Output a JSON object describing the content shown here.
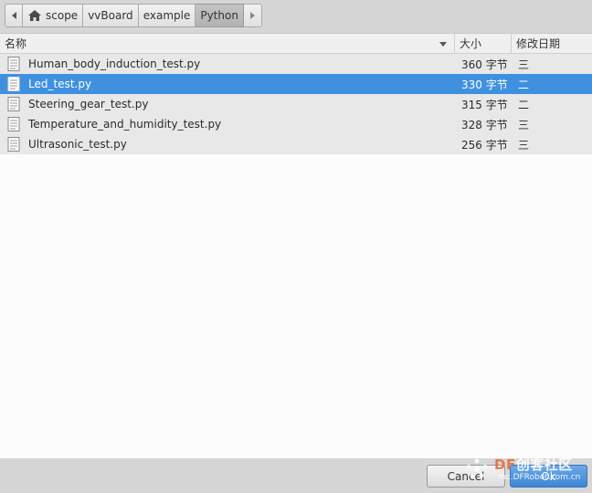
{
  "pathbar": {
    "crumbs": [
      "scope",
      "vvBoard",
      "example",
      "Python"
    ]
  },
  "columns": {
    "name": "名称",
    "size": "大小",
    "date": "修改日期"
  },
  "files": [
    {
      "name": "Human_body_induction_test.py",
      "size": "360 字节",
      "date": "三"
    },
    {
      "name": "Led_test.py",
      "size": "330 字节",
      "date": "二"
    },
    {
      "name": "Steering_gear_test.py",
      "size": "315 字节",
      "date": "二"
    },
    {
      "name": "Temperature_and_humidity_test.py",
      "size": "328 字节",
      "date": "三"
    },
    {
      "name": "Ultrasonic_test.py",
      "size": "256 字节",
      "date": "三"
    }
  ],
  "selected_index": 1,
  "buttons": {
    "cancel": "Cancel",
    "ok": "Ok"
  },
  "watermark": {
    "main_df": "DF",
    "main_rest": "创客社区",
    "sub": "mc.DFRobot.com.cn"
  },
  "colors": {
    "selection": "#3f91e0",
    "row_bg": "#e8e8e8",
    "list_bg": "#fcfcfc",
    "window_bg": "#d6d6d6"
  }
}
